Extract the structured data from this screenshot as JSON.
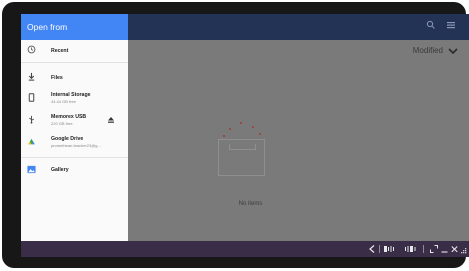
{
  "dialog": {
    "title": "Open from"
  },
  "nav": {
    "recent": "Recent",
    "files": "Files",
    "internal_storage": {
      "label": "Internal Storage",
      "sub": "44.44 GB free"
    },
    "usb": {
      "label": "Memorex USB",
      "sub": "220 GB free"
    },
    "drive": {
      "label": "Google Drive",
      "sub": "promethean.teacher23@g..."
    },
    "gallery": "Gallery"
  },
  "toolbar": {
    "sort_label": "Modified"
  },
  "content": {
    "empty_message": "No items"
  },
  "colors": {
    "accent": "#4285f4",
    "header_dark": "#233356",
    "shelf": "#3a2d47"
  },
  "icons": [
    "clock-icon",
    "download-icon",
    "phone-icon",
    "usb-icon",
    "eject-icon",
    "drive-icon",
    "gallery-icon",
    "search-icon",
    "view-menu-icon",
    "chevron-down-icon"
  ]
}
